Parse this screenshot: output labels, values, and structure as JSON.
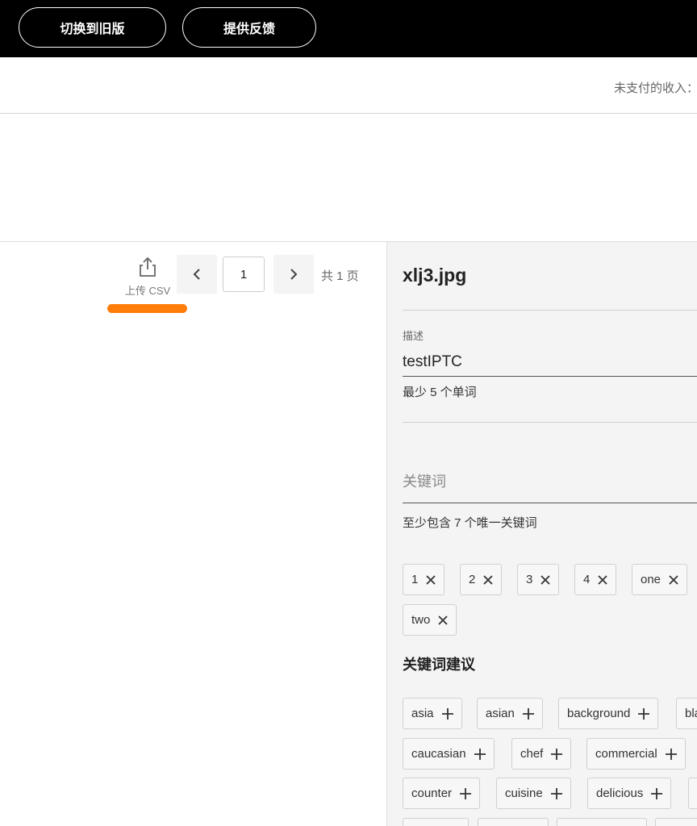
{
  "topbar": {
    "switch_label": "切换到旧版",
    "feedback_label": "提供反馈"
  },
  "header": {
    "unpaid_text": "未支付的收入："
  },
  "toolbar": {
    "upload_label": "上传 CSV",
    "page_value": "1",
    "page_total": "共 1 页",
    "accent_color": "#ff7d08"
  },
  "detail": {
    "filename": "xlj3.jpg",
    "description_label": "描述",
    "description_value": "testIPTC",
    "description_hint": "最少 5 个单词",
    "keywords_placeholder": "关键词",
    "keywords_hint": "至少包含 7 个唯一关键词",
    "keywords": [
      "1",
      "2",
      "3",
      "4",
      "one",
      "two"
    ],
    "suggestions_title": "关键词建议",
    "suggestions": [
      "asia",
      "asian",
      "background",
      "bla",
      "caucasian",
      "chef",
      "commercial",
      "counter",
      "cuisine",
      "delicious"
    ]
  }
}
